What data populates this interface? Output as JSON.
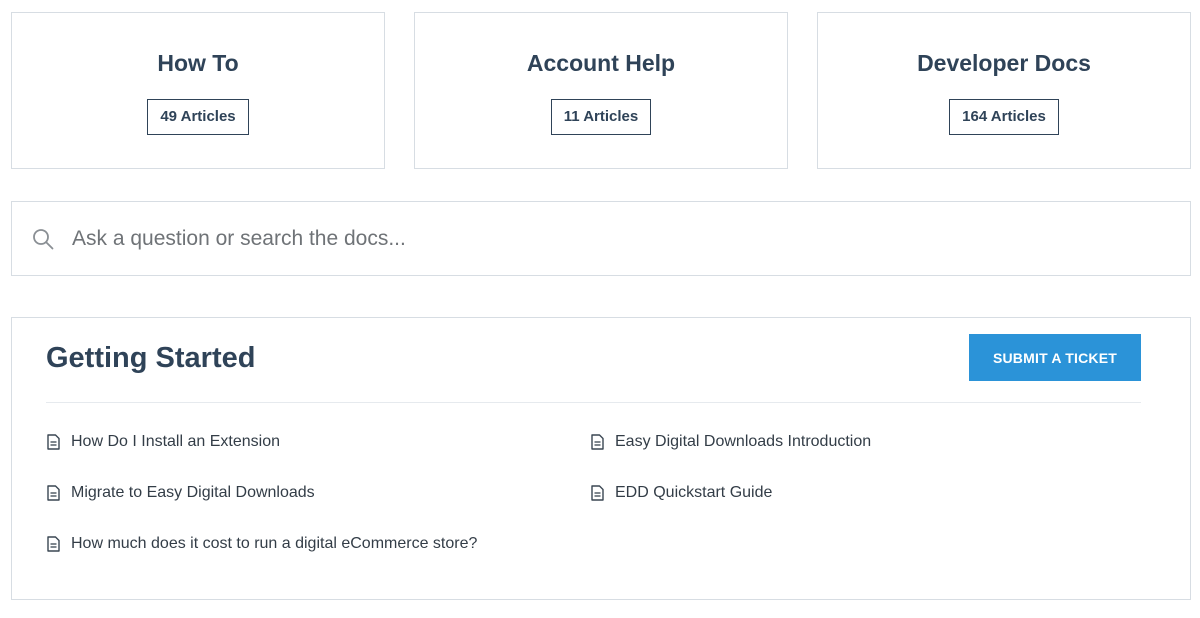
{
  "categories": [
    {
      "title": "How To",
      "count": "49 Articles"
    },
    {
      "title": "Account Help",
      "count": "11 Articles"
    },
    {
      "title": "Developer Docs",
      "count": "164 Articles"
    }
  ],
  "search": {
    "placeholder": "Ask a question or search the docs...",
    "value": "",
    "icon": "search-icon"
  },
  "section": {
    "title": "Getting Started",
    "button_label": "SUBMIT A TICKET",
    "button_color": "#2b93d8",
    "articles": [
      {
        "label": "How Do I Install an Extension",
        "icon": "document-icon"
      },
      {
        "label": "Easy Digital Downloads Introduction",
        "icon": "document-icon"
      },
      {
        "label": "Migrate to Easy Digital Downloads",
        "icon": "document-icon"
      },
      {
        "label": "EDD Quickstart Guide",
        "icon": "document-icon"
      },
      {
        "label": "How much does it cost to run a digital eCommerce store?",
        "icon": "document-icon"
      }
    ]
  },
  "colors": {
    "heading": "#2f4358",
    "border": "#d7dde3",
    "accent": "#2b93d8"
  }
}
